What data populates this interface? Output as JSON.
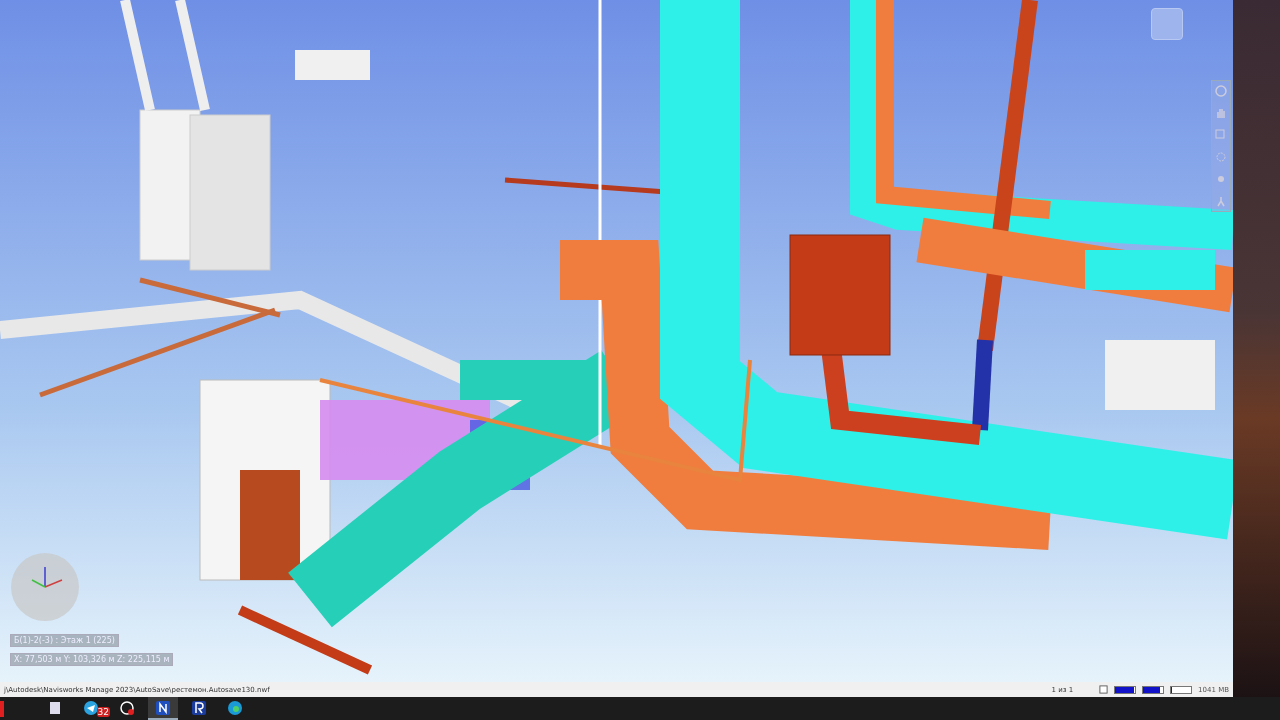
{
  "viewport": {
    "location_label": "Б(1)-2(-3) : Этаж 1 (225)",
    "coordinates": "X: 77,503 м  Y: 103,326 м  Z: 225,115 м"
  },
  "status_bar": {
    "file_path": "j\\Autodesk\\Navisworks Manage 2023\\AutoSave\\рестемон.Autosave130.nwf",
    "page_indicator": "1 из 1",
    "memory": "1041 MB",
    "meters": [
      {
        "level": 0.95
      },
      {
        "level": 0.85
      },
      {
        "level": 0.05
      }
    ]
  },
  "taskbar": {
    "apps": [
      {
        "kind": "notes",
        "selected": false
      },
      {
        "kind": "messenger",
        "selected": false,
        "badge": "32"
      },
      {
        "kind": "recorder",
        "selected": false
      },
      {
        "kind": "navisworks",
        "selected": true
      },
      {
        "kind": "revit",
        "selected": false
      },
      {
        "kind": "browser",
        "selected": false
      }
    ]
  }
}
